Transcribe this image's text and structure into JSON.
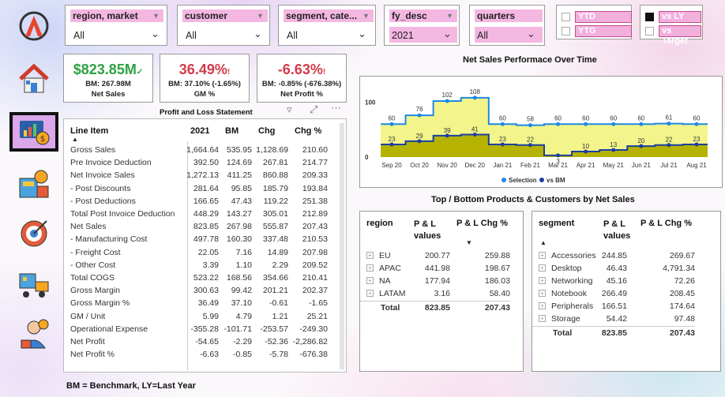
{
  "sidebar": {
    "items": [
      {
        "name": "logo",
        "icon": "atliq-logo-icon"
      },
      {
        "name": "home",
        "icon": "home-icon"
      },
      {
        "name": "finance-view",
        "icon": "finance-dashboard-icon"
      },
      {
        "name": "sales-view",
        "icon": "sales-icon"
      },
      {
        "name": "marketing-view",
        "icon": "marketing-target-icon"
      },
      {
        "name": "supply-chain-view",
        "icon": "supply-chain-icon"
      },
      {
        "name": "executive-view",
        "icon": "executive-icon"
      }
    ]
  },
  "slicers": [
    {
      "label": "region, market",
      "value": "All"
    },
    {
      "label": "customer",
      "value": "All"
    },
    {
      "label": "segment, cate...",
      "value": "All"
    },
    {
      "label": "fy_desc",
      "value": "2021"
    },
    {
      "label": "quarters",
      "value": "All"
    }
  ],
  "toggles": {
    "ytd": "YTD",
    "ytg": "YTG",
    "vs_ly": "vs LY",
    "vs_target": "vs Target"
  },
  "kpis": {
    "net_sales": {
      "value": "$823.85M",
      "bm": "BM: 267.98M",
      "label": "Net Sales"
    },
    "gm_pct": {
      "value": "36.49%",
      "bm": "BM: 37.10% (-1.65%)",
      "label": "GM %"
    },
    "net_profit_pct": {
      "value": "-6.63%",
      "bm": "BM: -0.85% (-676.38%)",
      "label": "Net Profit %"
    }
  },
  "pl": {
    "title": "Profit and Loss Statement",
    "columns": [
      "Line Item",
      "2021",
      "BM",
      "Chg",
      "Chg %"
    ],
    "rows": [
      [
        "Gross Sales",
        "1,664.64",
        "535.95",
        "1,128.69",
        "210.60"
      ],
      [
        "Pre Invoice Deduction",
        "392.50",
        "124.69",
        "267.81",
        "214.77"
      ],
      [
        "Net Invoice Sales",
        "1,272.13",
        "411.25",
        "860.88",
        "209.33"
      ],
      [
        "- Post Discounts",
        "281.64",
        "95.85",
        "185.79",
        "193.84"
      ],
      [
        "- Post Deductions",
        "166.65",
        "47.43",
        "119.22",
        "251.38"
      ],
      [
        "Total Post Invoice Deduction",
        "448.29",
        "143.27",
        "305.01",
        "212.89"
      ],
      [
        "Net Sales",
        "823.85",
        "267.98",
        "555.87",
        "207.43"
      ],
      [
        "- Manufacturing Cost",
        "497.78",
        "160.30",
        "337.48",
        "210.53"
      ],
      [
        "- Freight Cost",
        "22.05",
        "7.16",
        "14.89",
        "207.98"
      ],
      [
        "- Other Cost",
        "3.39",
        "1.10",
        "2.29",
        "209.52"
      ],
      [
        "Total COGS",
        "523.22",
        "168.56",
        "354.66",
        "210.41"
      ],
      [
        "Gross Margin",
        "300.63",
        "99.42",
        "201.21",
        "202.37"
      ],
      [
        "Gross Margin %",
        "36.49",
        "37.10",
        "-0.61",
        "-1.65"
      ],
      [
        "GM / Unit",
        "5.99",
        "4.79",
        "1.21",
        "25.21"
      ],
      [
        "Operational Expense",
        "-355.28",
        "-101.71",
        "-253.57",
        "-249.30"
      ],
      [
        "Net Profit",
        "-54.65",
        "-2.29",
        "-52.36",
        "-2,286.82"
      ],
      [
        "Net Profit %",
        "-6.63",
        "-0.85",
        "-5.78",
        "-676.38"
      ]
    ]
  },
  "chart_data": {
    "type": "area",
    "title": "Net Sales Performace Over Time",
    "categories": [
      "Sep 20",
      "Oct 20",
      "Nov 20",
      "Dec 20",
      "Jan 21",
      "Feb 21",
      "Mar 21",
      "Apr 21",
      "May 21",
      "Jun 21",
      "Jul 21",
      "Aug 21"
    ],
    "series": [
      {
        "name": "Selection",
        "values": [
          23,
          29,
          39,
          41,
          23,
          22,
          3,
          10,
          13,
          20,
          22,
          23
        ],
        "color": "#b5b300"
      },
      {
        "name": "vs BM",
        "values": [
          60,
          76,
          102,
          108,
          60,
          58,
          60,
          60,
          60,
          60,
          61,
          60
        ],
        "color": "#f3f58a"
      }
    ],
    "line_colors": {
      "Selection": "#1b3fa0",
      "vs BM": "#1e88e5"
    },
    "yticks": [
      0,
      100
    ],
    "ylim": [
      0,
      115
    ],
    "legend": "bottom",
    "grid": false
  },
  "region_table": {
    "title": "Top / Bottom Products & Customers by Net Sales",
    "columns": [
      "region",
      "P & L values",
      "P & L Chg %"
    ],
    "rows": [
      [
        "EU",
        "200.77",
        "259.88"
      ],
      [
        "APAC",
        "441.98",
        "198.67"
      ],
      [
        "NA",
        "177.94",
        "186.03"
      ],
      [
        "LATAM",
        "3.16",
        "58.40"
      ]
    ],
    "total": [
      "Total",
      "823.85",
      "207.43"
    ]
  },
  "segment_table": {
    "columns": [
      "segment",
      "P & L values",
      "P & L Chg %"
    ],
    "rows": [
      [
        "Accessories",
        "244.85",
        "269.67"
      ],
      [
        "Desktop",
        "46.43",
        "4,791.34"
      ],
      [
        "Networking",
        "45.16",
        "72.26"
      ],
      [
        "Notebook",
        "266.49",
        "208.45"
      ],
      [
        "Peripherals",
        "166.51",
        "174.64"
      ],
      [
        "Storage",
        "54.42",
        "97.48"
      ]
    ],
    "total": [
      "Total",
      "823.85",
      "207.43"
    ]
  },
  "footer": {
    "note": "BM = Benchmark, LY=Last Year"
  },
  "colors": {
    "accent_pink": "#f4b7e2",
    "positive": "#2ea043",
    "negative": "#d13b4a",
    "bar_selection": "#b5b300",
    "bar_bm": "#f3f58a"
  }
}
